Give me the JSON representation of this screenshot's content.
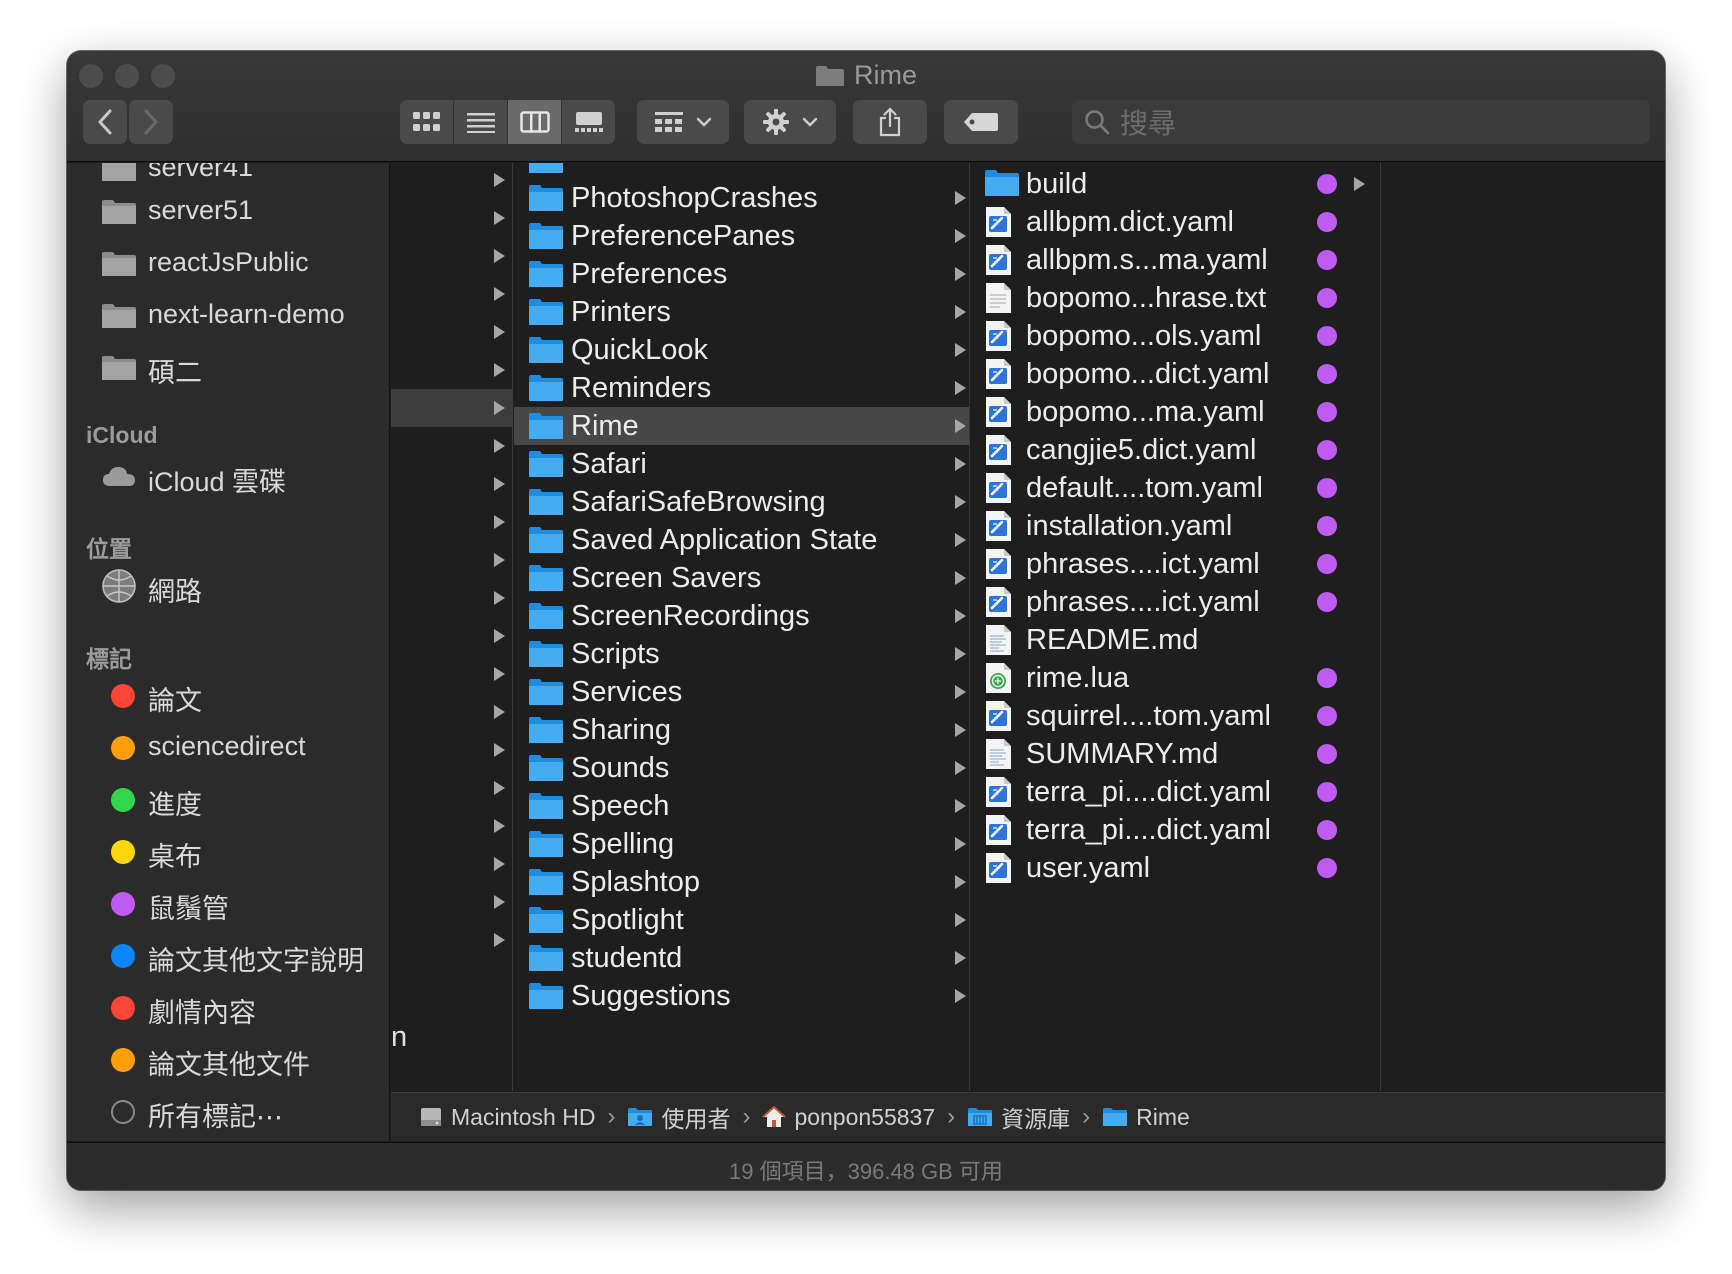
{
  "window": {
    "title": "Rime"
  },
  "toolbar": {
    "search_placeholder": "搜尋",
    "icons": [
      "back-icon",
      "forward-icon",
      "icon-view-icon",
      "list-view-icon",
      "column-view-icon",
      "gallery-view-icon",
      "group-icon",
      "gear-icon",
      "share-icon",
      "tag-icon",
      "search-icon"
    ]
  },
  "sidebar": {
    "locations_items": [
      {
        "label": "server41"
      },
      {
        "label": "server51"
      },
      {
        "label": "reactJsPublic"
      },
      {
        "label": "next-learn-demo"
      },
      {
        "label": "碩二"
      }
    ],
    "icloud_header": "iCloud",
    "icloud_item": "iCloud 雲碟",
    "places_header": "位置",
    "network_item": "網路",
    "tags_header": "標記",
    "tags": [
      {
        "label": "論文",
        "color": "#ff453a"
      },
      {
        "label": "sciencedirect",
        "color": "#ff9f0a"
      },
      {
        "label": "進度",
        "color": "#32d74b"
      },
      {
        "label": "桌布",
        "color": "#ffd60a"
      },
      {
        "label": "鼠鬚管",
        "color": "#bf5af2"
      },
      {
        "label": "論文其他文字說明",
        "color": "#0a84ff"
      },
      {
        "label": "劇情內容",
        "color": "#ff453a"
      },
      {
        "label": "論文其他文件",
        "color": "#ff9f0a"
      }
    ],
    "all_tags": "所有標記⋯"
  },
  "column1": {
    "partial_text": "n"
  },
  "column2": {
    "items": [
      "PhotoshopCrashes",
      "PreferencePanes",
      "Preferences",
      "Printers",
      "QuickLook",
      "Reminders",
      "Rime",
      "Safari",
      "SafariSafeBrowsing",
      "Saved Application State",
      "Screen Savers",
      "ScreenRecordings",
      "Scripts",
      "Services",
      "Sharing",
      "Sounds",
      "Speech",
      "Spelling",
      "Splashtop",
      "Spotlight",
      "studentd",
      "Suggestions"
    ],
    "selected": "Rime"
  },
  "column3": {
    "items": [
      {
        "name": "build",
        "kind": "folder",
        "tag": true
      },
      {
        "name": "allbpm.dict.yaml",
        "kind": "yaml",
        "tag": true
      },
      {
        "name": "allbpm.s...ma.yaml",
        "kind": "yaml",
        "tag": true
      },
      {
        "name": "bopomo...hrase.txt",
        "kind": "txt",
        "tag": true
      },
      {
        "name": "bopomo...ols.yaml",
        "kind": "yaml",
        "tag": true
      },
      {
        "name": "bopomo...dict.yaml",
        "kind": "yaml",
        "tag": true
      },
      {
        "name": "bopomo...ma.yaml",
        "kind": "yaml",
        "tag": true
      },
      {
        "name": "cangjie5.dict.yaml",
        "kind": "yaml",
        "tag": true
      },
      {
        "name": "default....tom.yaml",
        "kind": "yaml",
        "tag": true
      },
      {
        "name": "installation.yaml",
        "kind": "yaml",
        "tag": true
      },
      {
        "name": "phrases....ict.yaml",
        "kind": "yaml",
        "tag": true
      },
      {
        "name": "phrases....ict.yaml",
        "kind": "yaml",
        "tag": true
      },
      {
        "name": "README.md",
        "kind": "md",
        "tag": false
      },
      {
        "name": "rime.lua",
        "kind": "lua",
        "tag": true
      },
      {
        "name": "squirrel....tom.yaml",
        "kind": "yaml",
        "tag": true
      },
      {
        "name": "SUMMARY.md",
        "kind": "md",
        "tag": true
      },
      {
        "name": "terra_pi....dict.yaml",
        "kind": "yaml",
        "tag": true
      },
      {
        "name": "terra_pi....dict.yaml",
        "kind": "yaml",
        "tag": true
      },
      {
        "name": "user.yaml",
        "kind": "yaml",
        "tag": true
      }
    ],
    "tag_color": "#bf5af2"
  },
  "pathbar": {
    "crumbs": [
      {
        "label": "Macintosh HD",
        "icon": "hard-drive-icon"
      },
      {
        "label": "使用者",
        "icon": "users-folder-icon"
      },
      {
        "label": "ponpon55837",
        "icon": "home-icon"
      },
      {
        "label": "資源庫",
        "icon": "library-folder-icon"
      },
      {
        "label": "Rime",
        "icon": "folder-icon"
      }
    ]
  },
  "status": {
    "text": "19 個項目，396.48 GB 可用"
  }
}
